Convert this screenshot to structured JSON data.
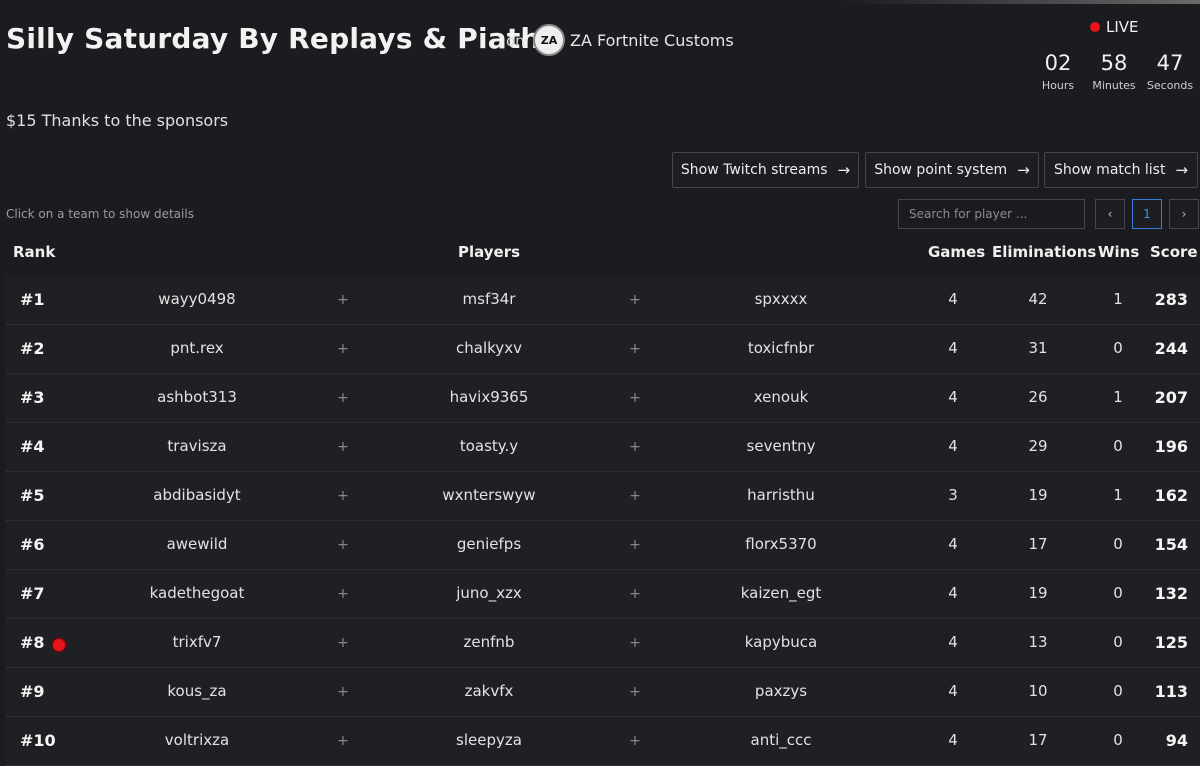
{
  "header": {
    "title": "Silly Saturday By Replays & Piath",
    "on_label": "on",
    "org_logo_text": "ZA",
    "org_name": "ZA Fortnite Customs"
  },
  "live": {
    "label": "LIVE",
    "countdown": [
      {
        "value": "02",
        "unit": "Hours"
      },
      {
        "value": "58",
        "unit": "Minutes"
      },
      {
        "value": "47",
        "unit": "Seconds"
      }
    ]
  },
  "sponsor_text": "$15 Thanks to the sponsors",
  "actions": {
    "twitch": "Show Twitch streams",
    "points": "Show point system",
    "matches": "Show match list"
  },
  "hint": "Click on a team to show details",
  "search": {
    "placeholder": "Search for player ..."
  },
  "pagination": {
    "prev": "‹",
    "current": "1",
    "next": "›"
  },
  "table": {
    "headers": {
      "rank": "Rank",
      "players": "Players",
      "games": "Games",
      "eliminations": "Eliminations",
      "wins": "Wins",
      "score": "Score"
    },
    "plus": "+",
    "rows": [
      {
        "rank": "#1",
        "p1": "wayy0498",
        "p2": "msf34r",
        "p3": "spxxxx",
        "games": "4",
        "elims": "42",
        "wins": "1",
        "score": "283"
      },
      {
        "rank": "#2",
        "p1": "pnt.rex",
        "p2": "chalkyxv",
        "p3": "toxicfnbr",
        "games": "4",
        "elims": "31",
        "wins": "0",
        "score": "244"
      },
      {
        "rank": "#3",
        "p1": "ashbot313",
        "p2": "havix9365",
        "p3": "xenouk",
        "games": "4",
        "elims": "26",
        "wins": "1",
        "score": "207"
      },
      {
        "rank": "#4",
        "p1": "travisza",
        "p2": "toasty.y",
        "p3": "seventny",
        "games": "4",
        "elims": "29",
        "wins": "0",
        "score": "196"
      },
      {
        "rank": "#5",
        "p1": "abdibasidyt",
        "p2": "wxnterswyw",
        "p3": "harristhu",
        "games": "3",
        "elims": "19",
        "wins": "1",
        "score": "162"
      },
      {
        "rank": "#6",
        "p1": "awewild",
        "p2": "geniefps",
        "p3": "florx5370",
        "games": "4",
        "elims": "17",
        "wins": "0",
        "score": "154"
      },
      {
        "rank": "#7",
        "p1": "kadethegoat",
        "p2": "juno_xzx",
        "p3": "kaizen_egt",
        "games": "4",
        "elims": "19",
        "wins": "0",
        "score": "132"
      },
      {
        "rank": "#8",
        "p1": "trixfv7",
        "p2": "zenfnb",
        "p3": "kapybuca",
        "games": "4",
        "elims": "13",
        "wins": "0",
        "score": "125",
        "live": true
      },
      {
        "rank": "#9",
        "p1": "kous_za",
        "p2": "zakvfx",
        "p3": "paxzys",
        "games": "4",
        "elims": "10",
        "wins": "0",
        "score": "113"
      },
      {
        "rank": "#10",
        "p1": "voltrixza",
        "p2": "sleepyza",
        "p3": "anti_ccc",
        "games": "4",
        "elims": "17",
        "wins": "0",
        "score": "94"
      }
    ]
  }
}
